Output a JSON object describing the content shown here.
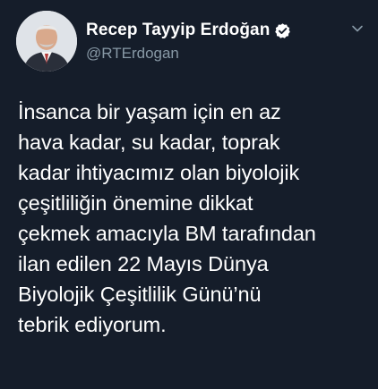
{
  "author": {
    "display_name": "Recep Tayyip Erdoğan",
    "handle": "@RTErdogan",
    "verified": true,
    "avatar_icon": "profile-photo"
  },
  "tweet": {
    "lines": [
      "İnsanca bir yaşam için en az",
      "hava kadar, su kadar, toprak",
      "kadar ihtiyacımız olan biyolojik",
      "çeşitliliğin önemine dikkat",
      "çekmek amacıyla BM tarafından",
      "ilan edilen 22 Mayıs Dünya",
      "Biyolojik Çeşitlilik Günü’nü",
      "tebrik ediyorum."
    ]
  },
  "colors": {
    "background": "#151d2a",
    "text": "#ffffff",
    "handle": "#8899a6",
    "verified_badge": "#ffffff"
  },
  "icons": {
    "verified": "verified-badge-icon",
    "menu": "chevron-down-icon"
  }
}
